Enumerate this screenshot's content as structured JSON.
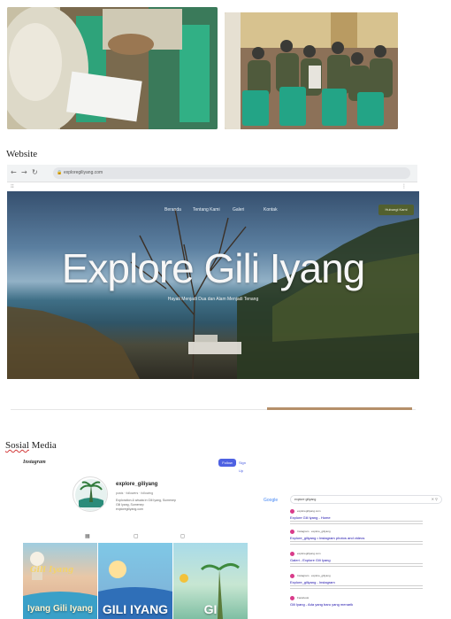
{
  "labels": {
    "website": "Website",
    "social_prefix": "Sosial",
    "social_suffix": " Media"
  },
  "browser": {
    "url": "exploregiliyang.com",
    "hero": {
      "nav_items": [
        "Beranda",
        "Tentang Kami",
        "Galeri",
        "Kontak"
      ],
      "cta": "Hubungi Kami",
      "title": "Explore Gili Iyang",
      "subtitle": "Hayati Menjadi Dua dan Alam Menjadi Tenang"
    }
  },
  "instagram": {
    "wordmark": "Instagram",
    "follow_label": "Follow",
    "signup_label": "Sign Up",
    "username": "explore_giliyang",
    "stats": "posts · followers · following",
    "bio": [
      "Exploration & wisata in Gili Iyang, Sumenep",
      "Gili Iyang, Sumenep",
      "exploregiliyang.com"
    ],
    "tiles": [
      {
        "script": "Gili Iyang",
        "text": "Iyang Gili Iyang"
      },
      {
        "text": "GILI IYANG"
      },
      {
        "text": "GI"
      }
    ]
  },
  "google": {
    "logo": "Google",
    "query": "explore giliyang",
    "results": [
      {
        "site": "exploregiliyang.com",
        "title": "Explore Gili Iyang - Home"
      },
      {
        "site": "Instagram · explore_giliyang",
        "title": "Explore_giliyang • Instagram photos and videos"
      },
      {
        "site": "exploregiliyang.com",
        "title": "Galeri - Explore Gili Iyang"
      },
      {
        "site": "Instagram · explore_giliyang",
        "title": "Explore_giliyang - Instagram"
      },
      {
        "site": "Facebook",
        "title": "Gili Iyang - Ada yang baru yang menarik"
      }
    ]
  },
  "colors": {
    "follow_button": "#4e61e2",
    "hero_cta": "#52602f",
    "google_link": "#1a0dab",
    "spellcheck_underline": "#d23a3a"
  },
  "icons": {
    "browser_back": "arrow-left-icon",
    "browser_forward": "arrow-right-icon",
    "browser_reload": "reload-icon",
    "address_lock": "lock-icon",
    "instagram_posts_tab": "grid-icon",
    "instagram_reels_tab": "play-icon",
    "instagram_tagged_tab": "tag-icon"
  }
}
